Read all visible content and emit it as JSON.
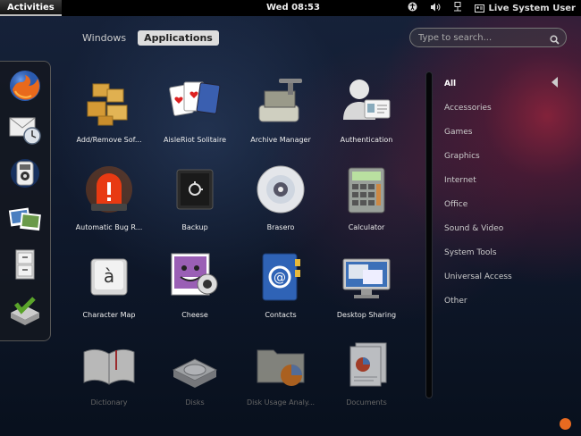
{
  "topbar": {
    "activities": "Activities",
    "clock": "Wed 08:53",
    "user": "Live System User",
    "tray_icons": [
      "accessibility-icon",
      "volume-icon",
      "network-icon",
      "user-icon"
    ]
  },
  "view_selector": {
    "windows": "Windows",
    "applications": "Applications"
  },
  "search": {
    "placeholder": "Type to search..."
  },
  "dash": {
    "items": [
      "firefox-icon",
      "evolution-icon",
      "rhythmbox-icon",
      "shotwell-icon",
      "file-cabinet-icon",
      "install-icon"
    ]
  },
  "apps": [
    {
      "label": "Add/Remove Sof...",
      "icon": "package-boxes-icon"
    },
    {
      "label": "AisleRiot Solitaire",
      "icon": "playing-cards-icon"
    },
    {
      "label": "Archive Manager",
      "icon": "archive-press-icon"
    },
    {
      "label": "Authentication",
      "icon": "id-card-icon"
    },
    {
      "label": "Automatic Bug R...",
      "icon": "alarm-light-icon"
    },
    {
      "label": "Backup",
      "icon": "safe-icon"
    },
    {
      "label": "Brasero",
      "icon": "cd-icon"
    },
    {
      "label": "Calculator",
      "icon": "calculator-icon"
    },
    {
      "label": "Character Map",
      "icon": "character-key-icon"
    },
    {
      "label": "Cheese",
      "icon": "webcam-icon"
    },
    {
      "label": "Contacts",
      "icon": "address-book-icon"
    },
    {
      "label": "Desktop Sharing",
      "icon": "monitor-icon"
    },
    {
      "label": "Dictionary",
      "icon": "open-book-icon"
    },
    {
      "label": "Disks",
      "icon": "disk-icon"
    },
    {
      "label": "Disk Usage Analy...",
      "icon": "folder-pie-icon"
    },
    {
      "label": "Documents",
      "icon": "documents-icon"
    }
  ],
  "categories": [
    "All",
    "Accessories",
    "Games",
    "Graphics",
    "Internet",
    "Office",
    "Sound & Video",
    "System Tools",
    "Universal Access",
    "Other"
  ],
  "selected_category": "All"
}
